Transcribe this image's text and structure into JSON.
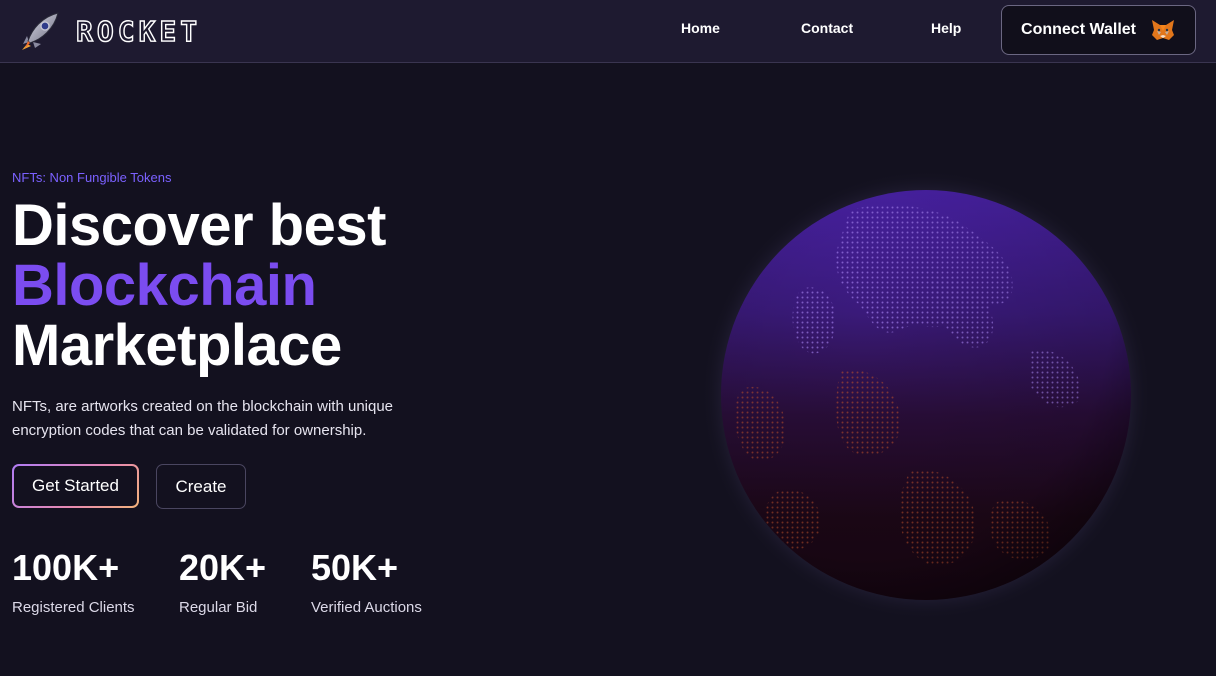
{
  "navbar": {
    "brand": "ROCKET",
    "links": [
      {
        "label": "Home"
      },
      {
        "label": "Contact"
      },
      {
        "label": "Help"
      }
    ],
    "connect_wallet": {
      "label": "Connect Wallet",
      "icon": "metamask-fox-icon"
    }
  },
  "hero": {
    "eyebrow": "NFTs: Non Fungible Tokens",
    "headline": {
      "line1": "Discover best",
      "line2": "Blockchain",
      "line3": "Marketplace"
    },
    "description": "NFTs, are artworks created on the blockchain with unique encryption codes that can be validated for ownership.",
    "primary_button": "Get Started",
    "secondary_button": "Create",
    "stats": [
      {
        "value": "100K+",
        "label": "Registered Clients"
      },
      {
        "value": "20K+",
        "label": "Regular Bid"
      },
      {
        "value": "50K+",
        "label": "Verified Auctions"
      }
    ]
  },
  "visual": {
    "globe_icon": "dotted-globe-icon"
  },
  "colors": {
    "background": "#13111f",
    "navbar": "#1e1a30",
    "accent": "#7b4cf0",
    "eyebrow": "#7b61ff"
  }
}
